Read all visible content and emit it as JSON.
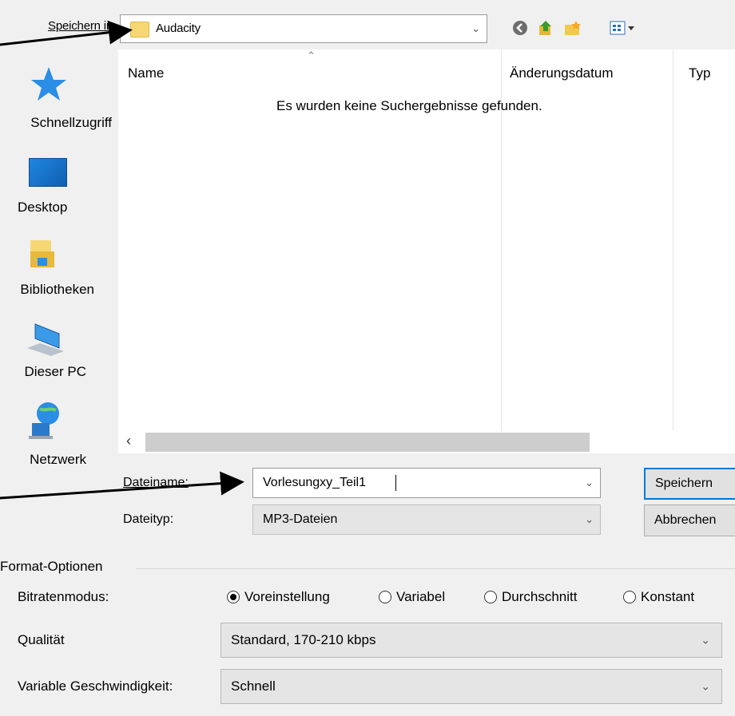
{
  "toolbar": {
    "save_in_label": "Speichern in:",
    "location": "Audacity"
  },
  "sidebar": {
    "items": [
      {
        "label": "Schnellzugriff",
        "icon": "star-icon"
      },
      {
        "label": "Desktop",
        "icon": "desktop-icon"
      },
      {
        "label": "Bibliotheken",
        "icon": "libraries-icon"
      },
      {
        "label": "Dieser PC",
        "icon": "computer-icon"
      },
      {
        "label": "Netzwerk",
        "icon": "network-icon"
      }
    ]
  },
  "file_list": {
    "columns": [
      "Name",
      "Änderungsdatum",
      "Typ"
    ],
    "empty_message": "Es wurden keine Suchergebnisse gefunden."
  },
  "form": {
    "filename_label": "Dateiname:",
    "filename_value": "Vorlesungxy_Teil1",
    "filetype_label": "Dateityp:",
    "filetype_value": "MP3-Dateien",
    "save_button": "Speichern",
    "cancel_button": "Abbrechen"
  },
  "options": {
    "group_title": "Format-Optionen",
    "bitrate_label": "Bitratenmodus:",
    "bitrate_modes": [
      "Voreinstellung",
      "Variabel",
      "Durchschnitt",
      "Konstant"
    ],
    "bitrate_selected": "Voreinstellung",
    "quality_label": "Qualität",
    "quality_value": "Standard, 170-210 kbps",
    "speed_label": "Variable Geschwindigkeit:",
    "speed_value": "Schnell"
  },
  "colors": {
    "accent": "#0078d7",
    "arrow": "#000000"
  }
}
